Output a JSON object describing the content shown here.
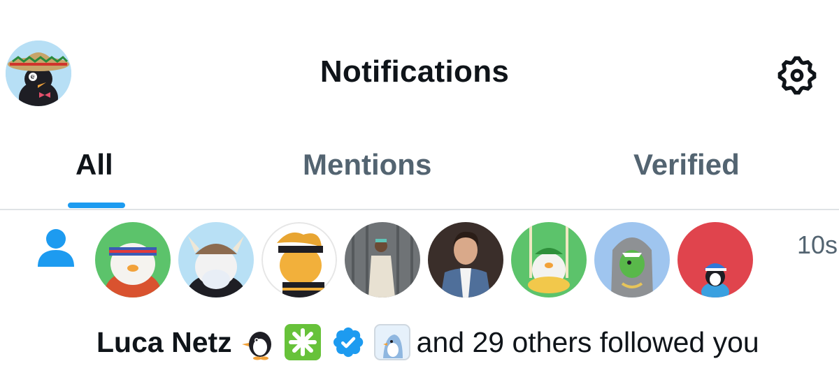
{
  "header": {
    "title": "Notifications",
    "profile_avatar_icon": "penguin-sombrero-avatar",
    "settings_icon": "gear-icon"
  },
  "tabs": [
    {
      "label": "All",
      "active": true
    },
    {
      "label": "Mentions",
      "active": false
    },
    {
      "label": "Verified",
      "active": false
    }
  ],
  "notification": {
    "type_icon": "person-icon",
    "timestamp": "10s",
    "avatars": [
      "penguin-headband-avatar",
      "penguin-viking-avatar",
      "penguin-ninja-avatar",
      "man-white-outfit-photo-avatar",
      "man-denim-jacket-photo-avatar",
      "penguin-swing-avatar",
      "penguin-shark-costume-avatar",
      "penguin-red-background-avatar"
    ],
    "name": "Luca Netz",
    "name_badges": [
      "penguin-emoji",
      "sparkle-green-emoji",
      "verified-badge-icon",
      "penguin-badge-icon"
    ],
    "rest_text": "and 29 others followed you",
    "colors": {
      "accent": "#1d9bf0",
      "secondary_text": "#536471"
    }
  }
}
